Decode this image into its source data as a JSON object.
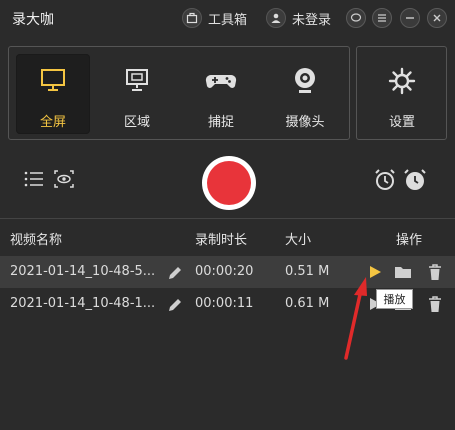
{
  "app": {
    "title": "录大咖",
    "toolbox_label": "工具箱",
    "login_label": "未登录"
  },
  "modes": [
    {
      "label": "全屏",
      "icon": "monitor-icon",
      "active": true
    },
    {
      "label": "区域",
      "icon": "region-icon",
      "active": false
    },
    {
      "label": "捕捉",
      "icon": "gamepad-icon",
      "active": false
    },
    {
      "label": "摄像头",
      "icon": "webcam-icon",
      "active": false
    }
  ],
  "settings": {
    "label": "设置",
    "icon": "gear-icon"
  },
  "table": {
    "headers": {
      "name": "视频名称",
      "duration": "录制时长",
      "size": "大小",
      "actions": "操作"
    },
    "rows": [
      {
        "name": "2021-01-14_10-48-5...",
        "duration": "00:00:20",
        "size": "0.51 M",
        "selected": true
      },
      {
        "name": "2021-01-14_10-48-1...",
        "duration": "00:00:11",
        "size": "0.61 M",
        "selected": false
      }
    ]
  },
  "tooltip": {
    "text": "播放"
  },
  "colors": {
    "background": "#2b2b2b",
    "accent": "#f4c542",
    "record": "#e8343a",
    "annotation_arrow": "#e02a2a"
  }
}
